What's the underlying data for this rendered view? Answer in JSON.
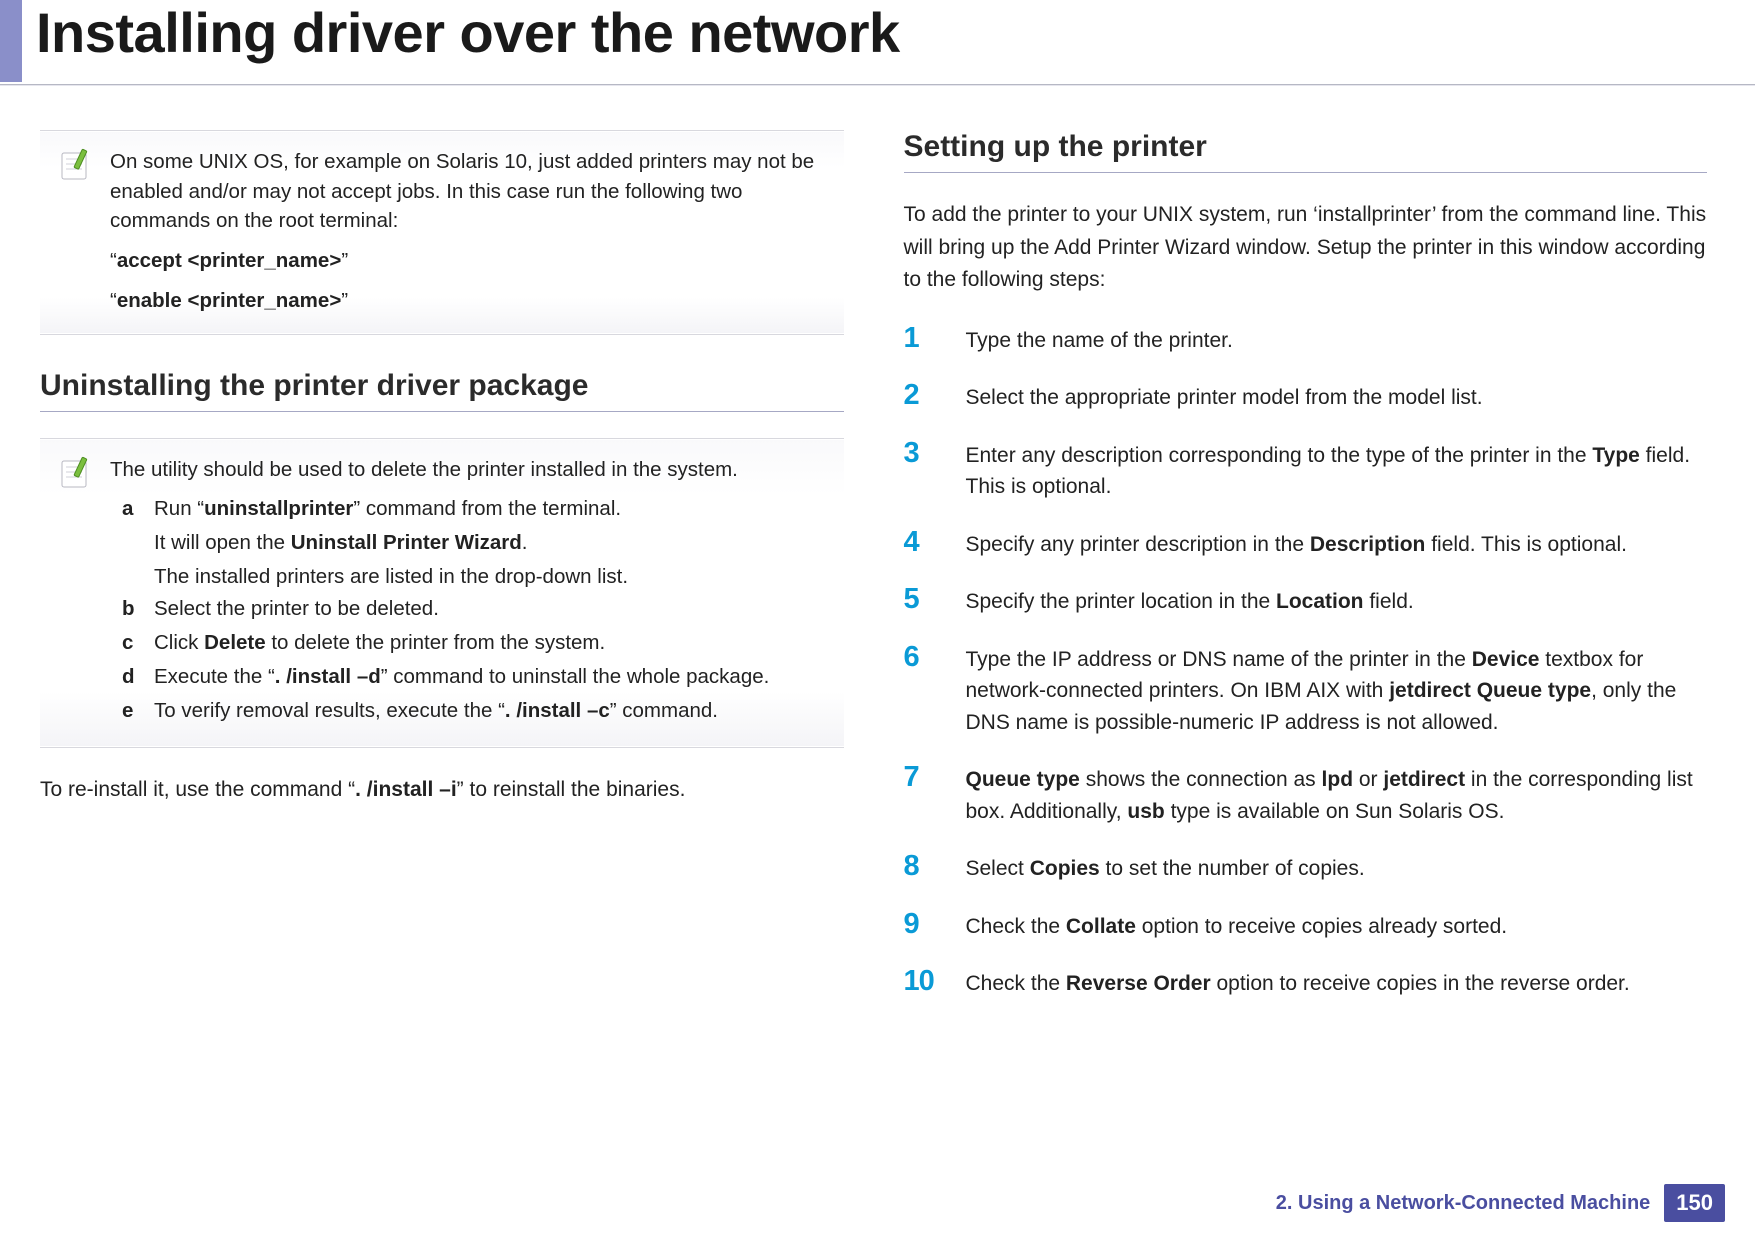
{
  "title": "Installing driver over the network",
  "left": {
    "note1": {
      "p1": "On some UNIX OS, for example on Solaris 10, just added printers may not be enabled and/or may not accept jobs. In this case run the following two commands on the root terminal:",
      "cmd1_pre": "“",
      "cmd1_bold": "accept <printer_name>",
      "cmd1_post": "”",
      "cmd2_pre": "“",
      "cmd2_bold": "enable <printer_name>",
      "cmd2_post": "”"
    },
    "section1_heading": "Uninstalling the printer driver package",
    "note2": {
      "intro": "The utility should be used to delete the printer installed in the system.",
      "a": {
        "letter": "a",
        "l1_pre": "Run “",
        "l1_bold": "uninstallprinter",
        "l1_post": "” command from the terminal.",
        "l2_pre": "It will open the ",
        "l2_bold": "Uninstall Printer Wizard",
        "l2_post": ".",
        "l3": "The installed printers are listed in the drop-down list."
      },
      "b": {
        "letter": "b",
        "text": "Select the printer to be deleted."
      },
      "c": {
        "letter": "c",
        "pre": "Click ",
        "bold": "Delete",
        "post": " to delete the printer from the system."
      },
      "d": {
        "letter": "d",
        "pre": "Execute the “",
        "bold": ". /install –d",
        "post": "” command to uninstall the whole package."
      },
      "e": {
        "letter": "e",
        "pre": "To verify removal results, execute the “",
        "bold": ". /install –c",
        "post": "” command."
      }
    },
    "reinstall": {
      "pre": "To re-install it, use the command “",
      "bold": ". /install –i",
      "post": "” to reinstall the binaries."
    }
  },
  "right": {
    "section_heading": "Setting up the printer",
    "intro": "To add the printer to your UNIX system, run ‘installprinter’ from the command line. This will bring up the Add Printer Wizard window. Setup the printer in this window according to the following steps:",
    "steps": {
      "s1": {
        "n": "1",
        "text": "Type the name of the printer."
      },
      "s2": {
        "n": "2",
        "text": "Select the appropriate printer model from the model list."
      },
      "s3": {
        "n": "3",
        "pre": "Enter any description corresponding to the type of the printer in the ",
        "bold": "Type",
        "post": " field. This is optional."
      },
      "s4": {
        "n": "4",
        "pre": "Specify any printer description in the ",
        "bold": "Description",
        "post": " field. This is optional."
      },
      "s5": {
        "n": "5",
        "pre": "Specify the printer location in the ",
        "bold": "Location",
        "post": " field."
      },
      "s6": {
        "n": "6",
        "pre": "Type the IP address or DNS name of the printer in the ",
        "bold1": "Device",
        "mid": " textbox for network-connected printers. On IBM AIX with ",
        "bold2": "jetdirect Queue type",
        "post": ", only the DNS name is possible-numeric IP address is not allowed."
      },
      "s7": {
        "n": "7",
        "bold1": "Queue type",
        "t1": " shows the connection as ",
        "bold2": "lpd",
        "t2": " or ",
        "bold3": "jetdirect",
        "t3": " in the corresponding list box. Additionally, ",
        "bold4": "usb",
        "t4": " type is available on Sun Solaris OS."
      },
      "s8": {
        "n": "8",
        "pre": "Select ",
        "bold": "Copies",
        "post": " to set the number of copies."
      },
      "s9": {
        "n": "9",
        "pre": "Check the ",
        "bold": "Collate",
        "post": " option to receive copies already sorted."
      },
      "s10": {
        "n": "10",
        "pre": "Check the ",
        "bold": "Reverse Order",
        "post": " option to receive copies in the reverse order."
      }
    }
  },
  "footer": {
    "chapter": "2.  Using a Network-Connected Machine",
    "page": "150"
  }
}
